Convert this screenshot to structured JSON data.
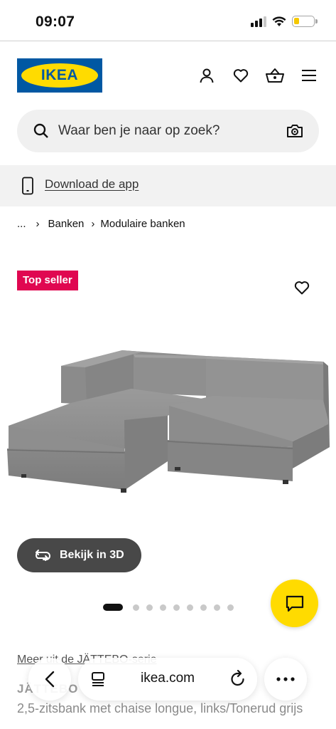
{
  "status_bar": {
    "time": "09:07"
  },
  "header": {
    "logo_text": "IKEA",
    "icons": [
      "account-icon",
      "heart-icon",
      "basket-icon",
      "menu-icon"
    ]
  },
  "search": {
    "placeholder": "Waar ben je naar op zoek?"
  },
  "app_banner": {
    "label": "Download de app"
  },
  "breadcrumb": {
    "items": [
      "...",
      "Banken",
      "Modulaire banken"
    ]
  },
  "product": {
    "badge": "Top seller",
    "view_3d_label": "Bekijk in 3D",
    "carousel": {
      "total": 10,
      "active": 1
    },
    "series_link": "Meer uit de JÄTTEBO-serie",
    "name": "JÄTTEBO",
    "description": "2,5-zitsbank met chaise longue, links/Tonerud grijs"
  },
  "browser": {
    "domain": "ikea.com"
  },
  "colors": {
    "ikea_blue": "#0058a3",
    "ikea_yellow": "#ffdb00",
    "badge_red": "#e00751",
    "sofa_grey": "#8e8e8e"
  }
}
